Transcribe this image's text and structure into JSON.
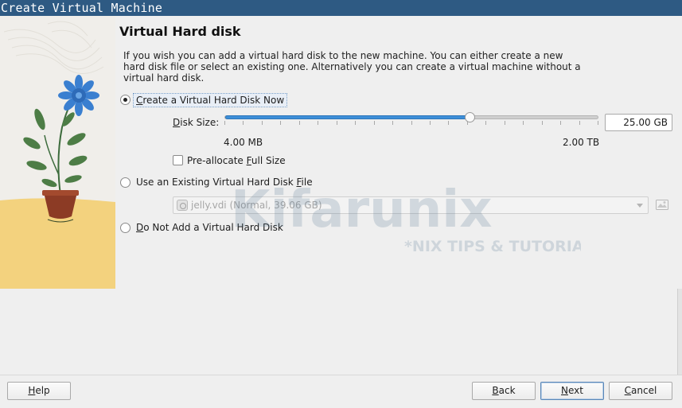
{
  "window": {
    "title": "Create Virtual Machine"
  },
  "page": {
    "heading": "Virtual Hard disk",
    "description": "If you wish you can add a virtual hard disk to the new machine. You can either create a new hard disk file or select an existing one. Alternatively you can create a virtual machine without a virtual hard disk."
  },
  "options": {
    "create_new": {
      "label_pre": "",
      "label_key": "C",
      "label_post": "reate a Virtual Hard Disk Now",
      "selected": true
    },
    "use_existing": {
      "label_pre": "Use an Existing Virtual Hard Disk ",
      "label_key": "F",
      "label_post": "ile",
      "selected": false
    },
    "no_disk": {
      "label_pre": "",
      "label_key": "D",
      "label_post": "o Not Add a Virtual Hard Disk",
      "selected": false
    }
  },
  "disk_size": {
    "label_pre": "",
    "label_key": "D",
    "label_post": "isk Size:",
    "value": "25.00 GB",
    "min_label": "4.00 MB",
    "max_label": "2.00 TB",
    "slider_fraction": 0.655
  },
  "preallocate": {
    "label_pre": "Pre-allocate ",
    "label_key": "F",
    "label_post": "ull Size",
    "checked": false
  },
  "existing_file": {
    "selected": "jelly.vdi (Normal, 39.06 GB)",
    "disabled": true
  },
  "watermark": {
    "brand": "Kifarunix",
    "tagline": "*NIX TIPS & TUTORIALS"
  },
  "buttons": {
    "help": {
      "pre": "",
      "key": "H",
      "post": "elp"
    },
    "back": {
      "pre": "",
      "key": "B",
      "post": "ack"
    },
    "next": {
      "pre": "",
      "key": "N",
      "post": "ext"
    },
    "cancel": {
      "pre": "",
      "key": "C",
      "post": "ancel"
    }
  },
  "colors": {
    "titlebar": "#2e5a83",
    "slider_fill": "#3d8ed8",
    "accent_flower": "#3a7fd0",
    "floor": "#f3d27e"
  }
}
